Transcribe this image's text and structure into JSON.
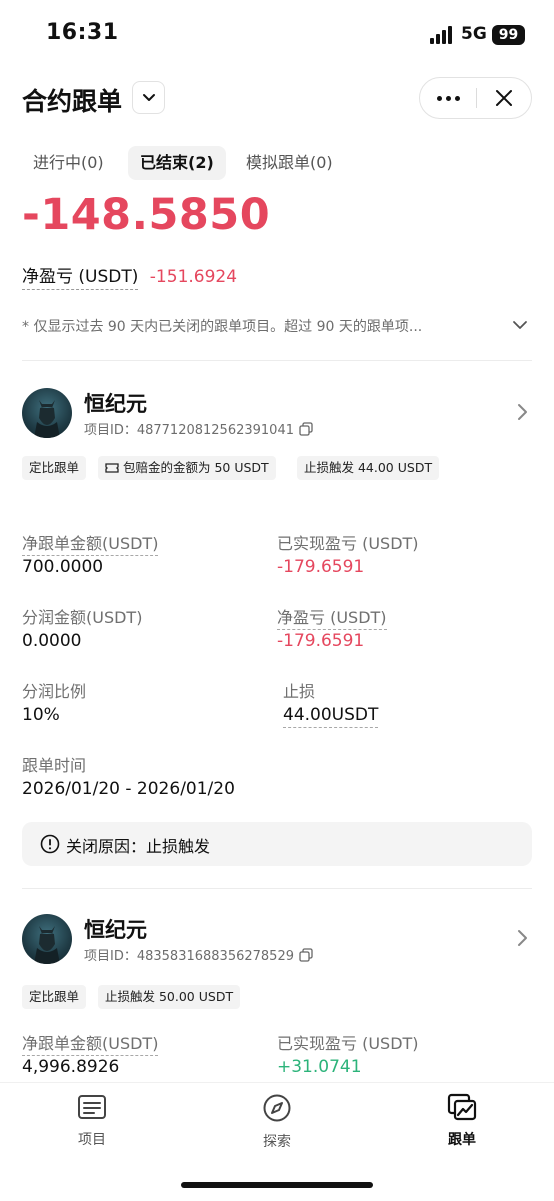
{
  "status_bar": {
    "time": "16:31",
    "network": "5G",
    "battery": "99"
  },
  "header": {
    "title": "合约跟单"
  },
  "tabs": [
    {
      "label": "进行中(0)"
    },
    {
      "label": "已结束(2)"
    },
    {
      "label": "模拟跟单(0)"
    }
  ],
  "summary": {
    "total_pnl": "-148.5850",
    "net_pnl_label": "净盈亏 (USDT)",
    "net_pnl_value": "-151.6924",
    "note": "* 仅显示过去 90 天内已关闭的跟单项目。超过 90 天的跟单项..."
  },
  "cards": [
    {
      "name": "恒纪元",
      "project_id": "项目ID：4877120812562391041",
      "tags": [
        "定比跟单",
        "包赔金的金额为 50 USDT",
        "止损触发 44.00 USDT"
      ],
      "fields": {
        "net_amount_label": "净跟单金额(USDT)",
        "net_amount_value": "700.0000",
        "realized_pnl_label": "已实现盈亏 (USDT)",
        "realized_pnl_value": "-179.6591",
        "profit_share_label": "分润金额(USDT)",
        "profit_share_value": "0.0000",
        "net_pnl_label": "净盈亏 (USDT)",
        "net_pnl_value": "-179.6591",
        "share_ratio_label": "分润比例",
        "share_ratio_value": "10%",
        "stop_loss_label": "止损",
        "stop_loss_value": "44.00USDT",
        "time_label": "跟单时间",
        "time_value": "2026/01/20 - 2026/01/20"
      },
      "close_reason": "关闭原因：止损触发"
    },
    {
      "name": "恒纪元",
      "project_id": "项目ID：4835831688356278529",
      "tags": [
        "定比跟单",
        "止损触发 50.00 USDT"
      ],
      "fields": {
        "net_amount_label": "净跟单金额(USDT)",
        "net_amount_value": "4,996.8926",
        "realized_pnl_label": "已实现盈亏 (USDT)",
        "realized_pnl_value": "+31.0741"
      }
    }
  ],
  "bottom_nav": [
    {
      "label": "项目",
      "icon": "list-card-icon"
    },
    {
      "label": "探索",
      "icon": "compass-icon"
    },
    {
      "label": "跟单",
      "icon": "copy-trade-chart-icon"
    }
  ],
  "colors": {
    "loss": "#e5475e",
    "profit": "#2cb37a"
  }
}
